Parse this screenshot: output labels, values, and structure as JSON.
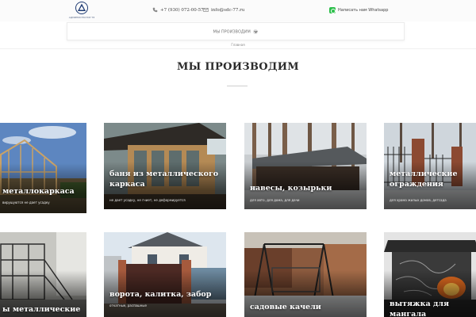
{
  "header": {
    "logo_text": "АДМИНИСТРАТОР ТЭ",
    "phone": "+7 (930) 072-00-57",
    "email": "info@sdc-77.ru",
    "whatsapp": "Написать нам Whatsapp"
  },
  "nav": {
    "menu_label": "МЫ ПРОИЗВОДИМ"
  },
  "breadcrumb": "Главная",
  "page_title": "МЫ ПРОИЗВОДИМ",
  "cards": [
    {
      "title": "металлокаркаса",
      "subtitle": "вирушуются не дает усадку"
    },
    {
      "title": "баня из металлического каркаса",
      "subtitle": "не дает усадку, не гниет, не деформируется"
    },
    {
      "title": "навесы, козырьки",
      "subtitle": "для авто, для дома, для дачи"
    },
    {
      "title": "металлические ограждения",
      "subtitle": "для храма жилых домов, детсада"
    },
    {
      "title": "ы металлические",
      "subtitle": ""
    },
    {
      "title": "ворота, калитка, забор",
      "subtitle": "откатные, распашные"
    },
    {
      "title": "садовые качели",
      "subtitle": ""
    },
    {
      "title": "вытяжка для мангала",
      "subtitle": ""
    }
  ],
  "colors": {
    "whatsapp_green": "#2cbf4a",
    "title_text": "#2b2b2b",
    "card_text": "#ffffff"
  }
}
